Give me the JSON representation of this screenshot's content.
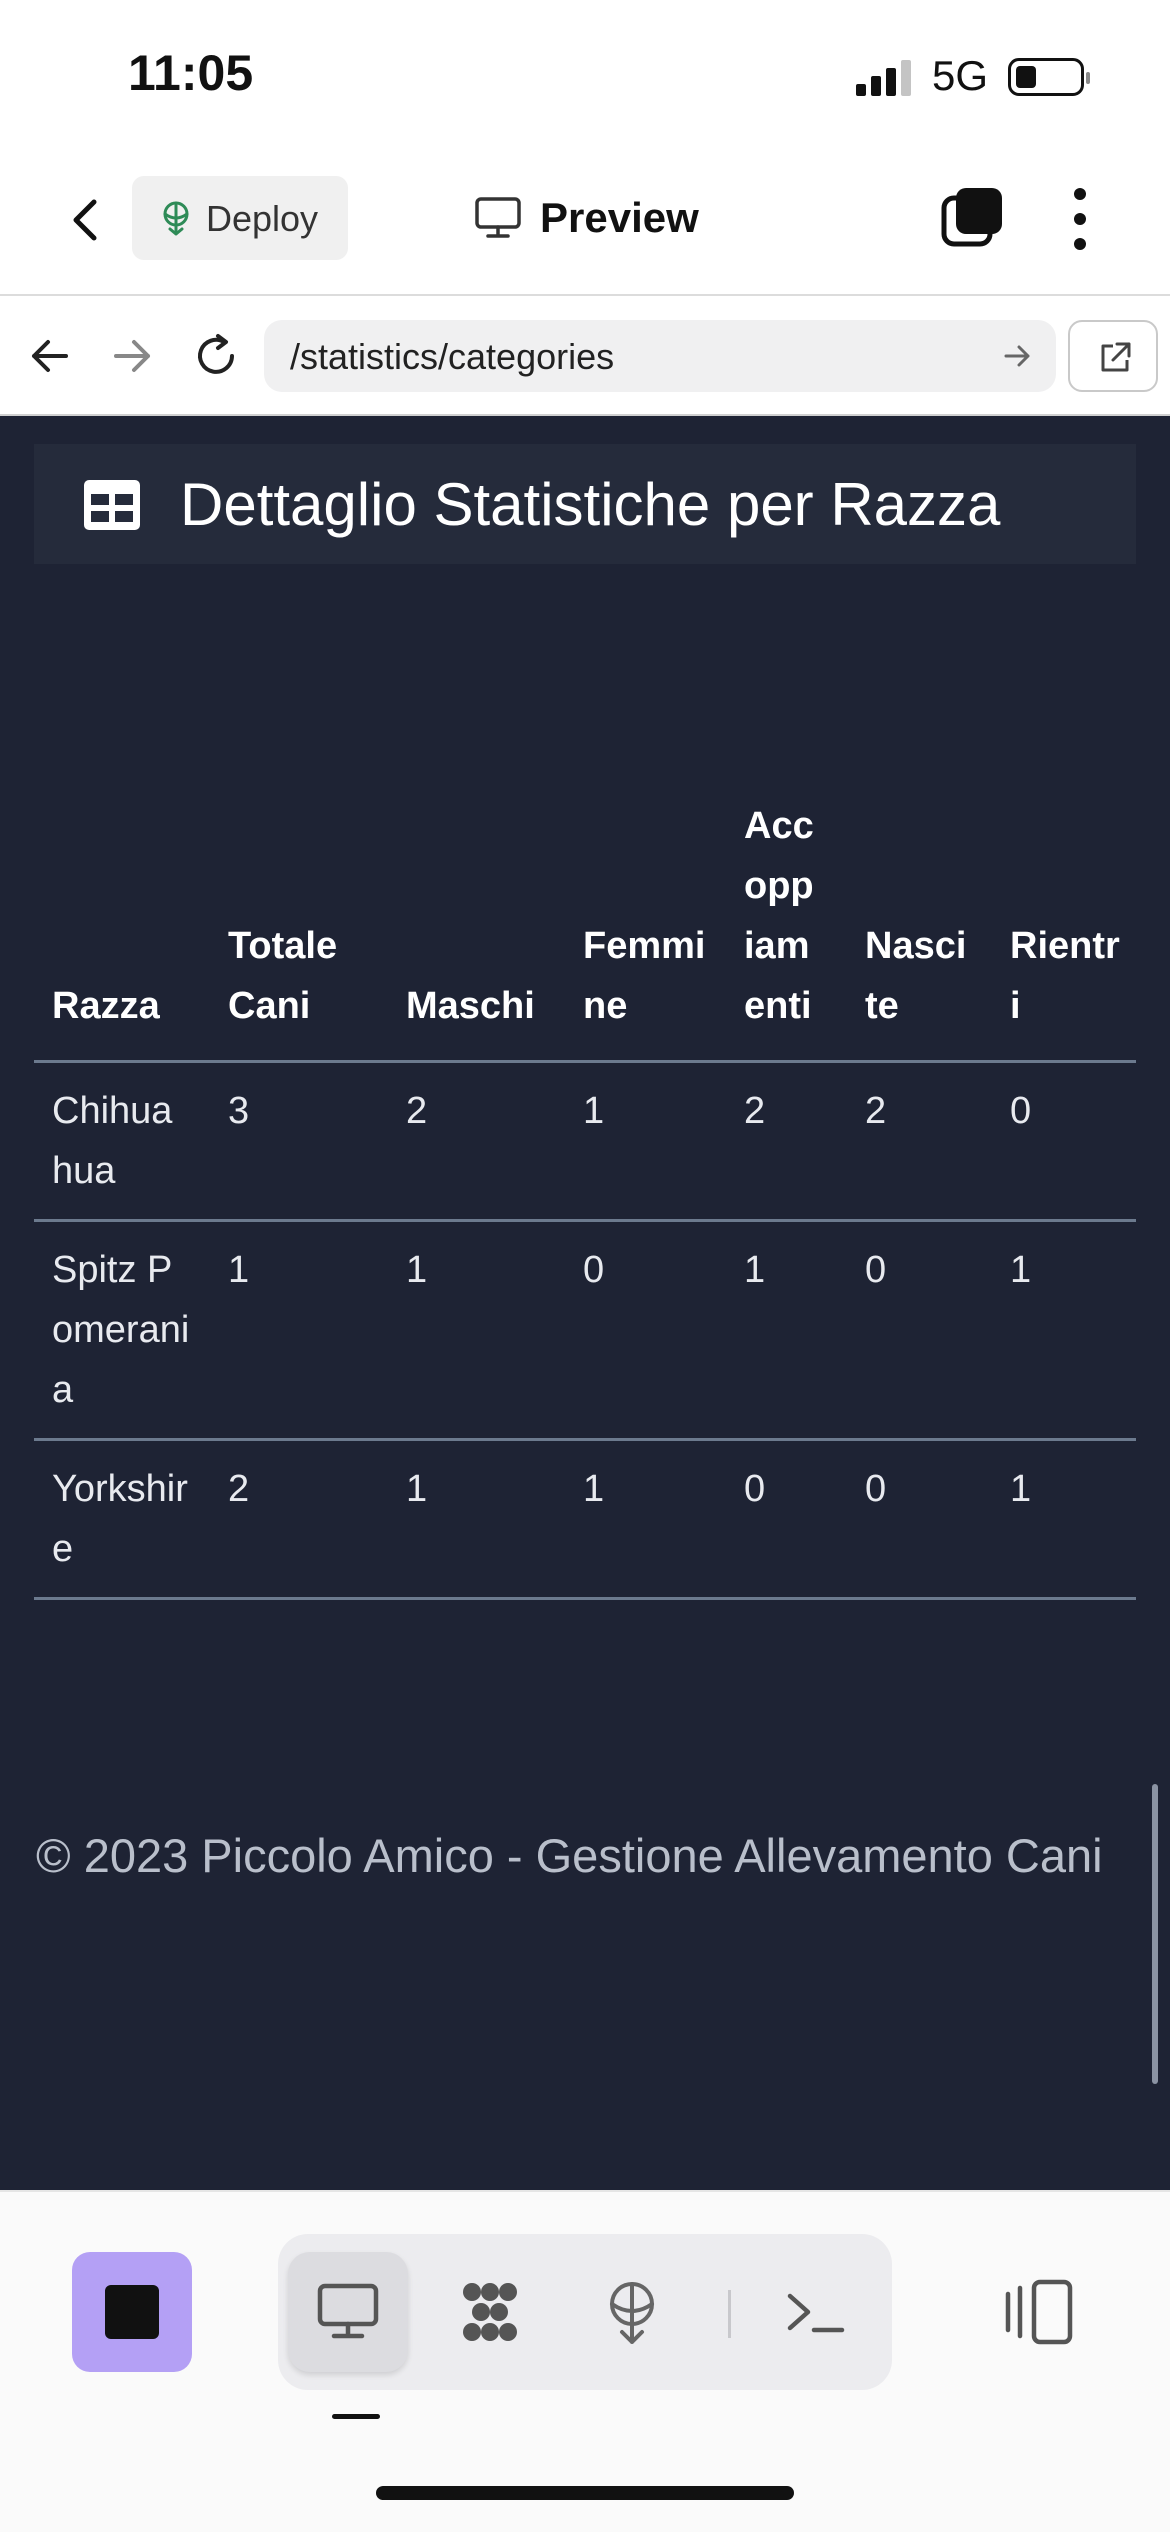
{
  "status_bar": {
    "time": "11:05",
    "network": "5G",
    "signal_bars": 3,
    "battery_level": 0.3
  },
  "app_toolbar": {
    "deploy_label": "Deploy",
    "preview_label": "Preview"
  },
  "browser": {
    "url": "/statistics/categories"
  },
  "card": {
    "title": "Dettaglio Statistiche per Razza",
    "columns": [
      "Razza",
      "Totale Cani",
      "Maschi",
      "Femmine",
      "Accoppiamenti",
      "Nascite",
      "Rientri"
    ],
    "rows": [
      [
        "Chihuahua",
        "3",
        "2",
        "1",
        "2",
        "2",
        "0"
      ],
      [
        "Spitz Pomerania",
        "1",
        "1",
        "0",
        "1",
        "0",
        "1"
      ],
      [
        "Yorkshire",
        "2",
        "1",
        "1",
        "0",
        "0",
        "1"
      ]
    ]
  },
  "footer": {
    "text": "© 2023 Piccolo Amico - Gestione Allevamento Cani"
  },
  "colors": {
    "page_bg": "#1e2334",
    "card_header_bg": "#252b3b",
    "stop_button": "#b4a0f5"
  },
  "icons": {
    "toolbar": [
      "back-icon",
      "deploy-icon",
      "monitor-icon",
      "tabs-icon",
      "more-icon"
    ],
    "browser": [
      "arrow-back-icon",
      "arrow-forward-icon",
      "reload-icon",
      "go-icon",
      "external-link-icon"
    ],
    "card": [
      "table-icon"
    ],
    "dock": [
      "stop-icon",
      "monitor-icon",
      "workflow-icon",
      "deploy-icon",
      "terminal-icon",
      "sidebar-icon"
    ]
  }
}
